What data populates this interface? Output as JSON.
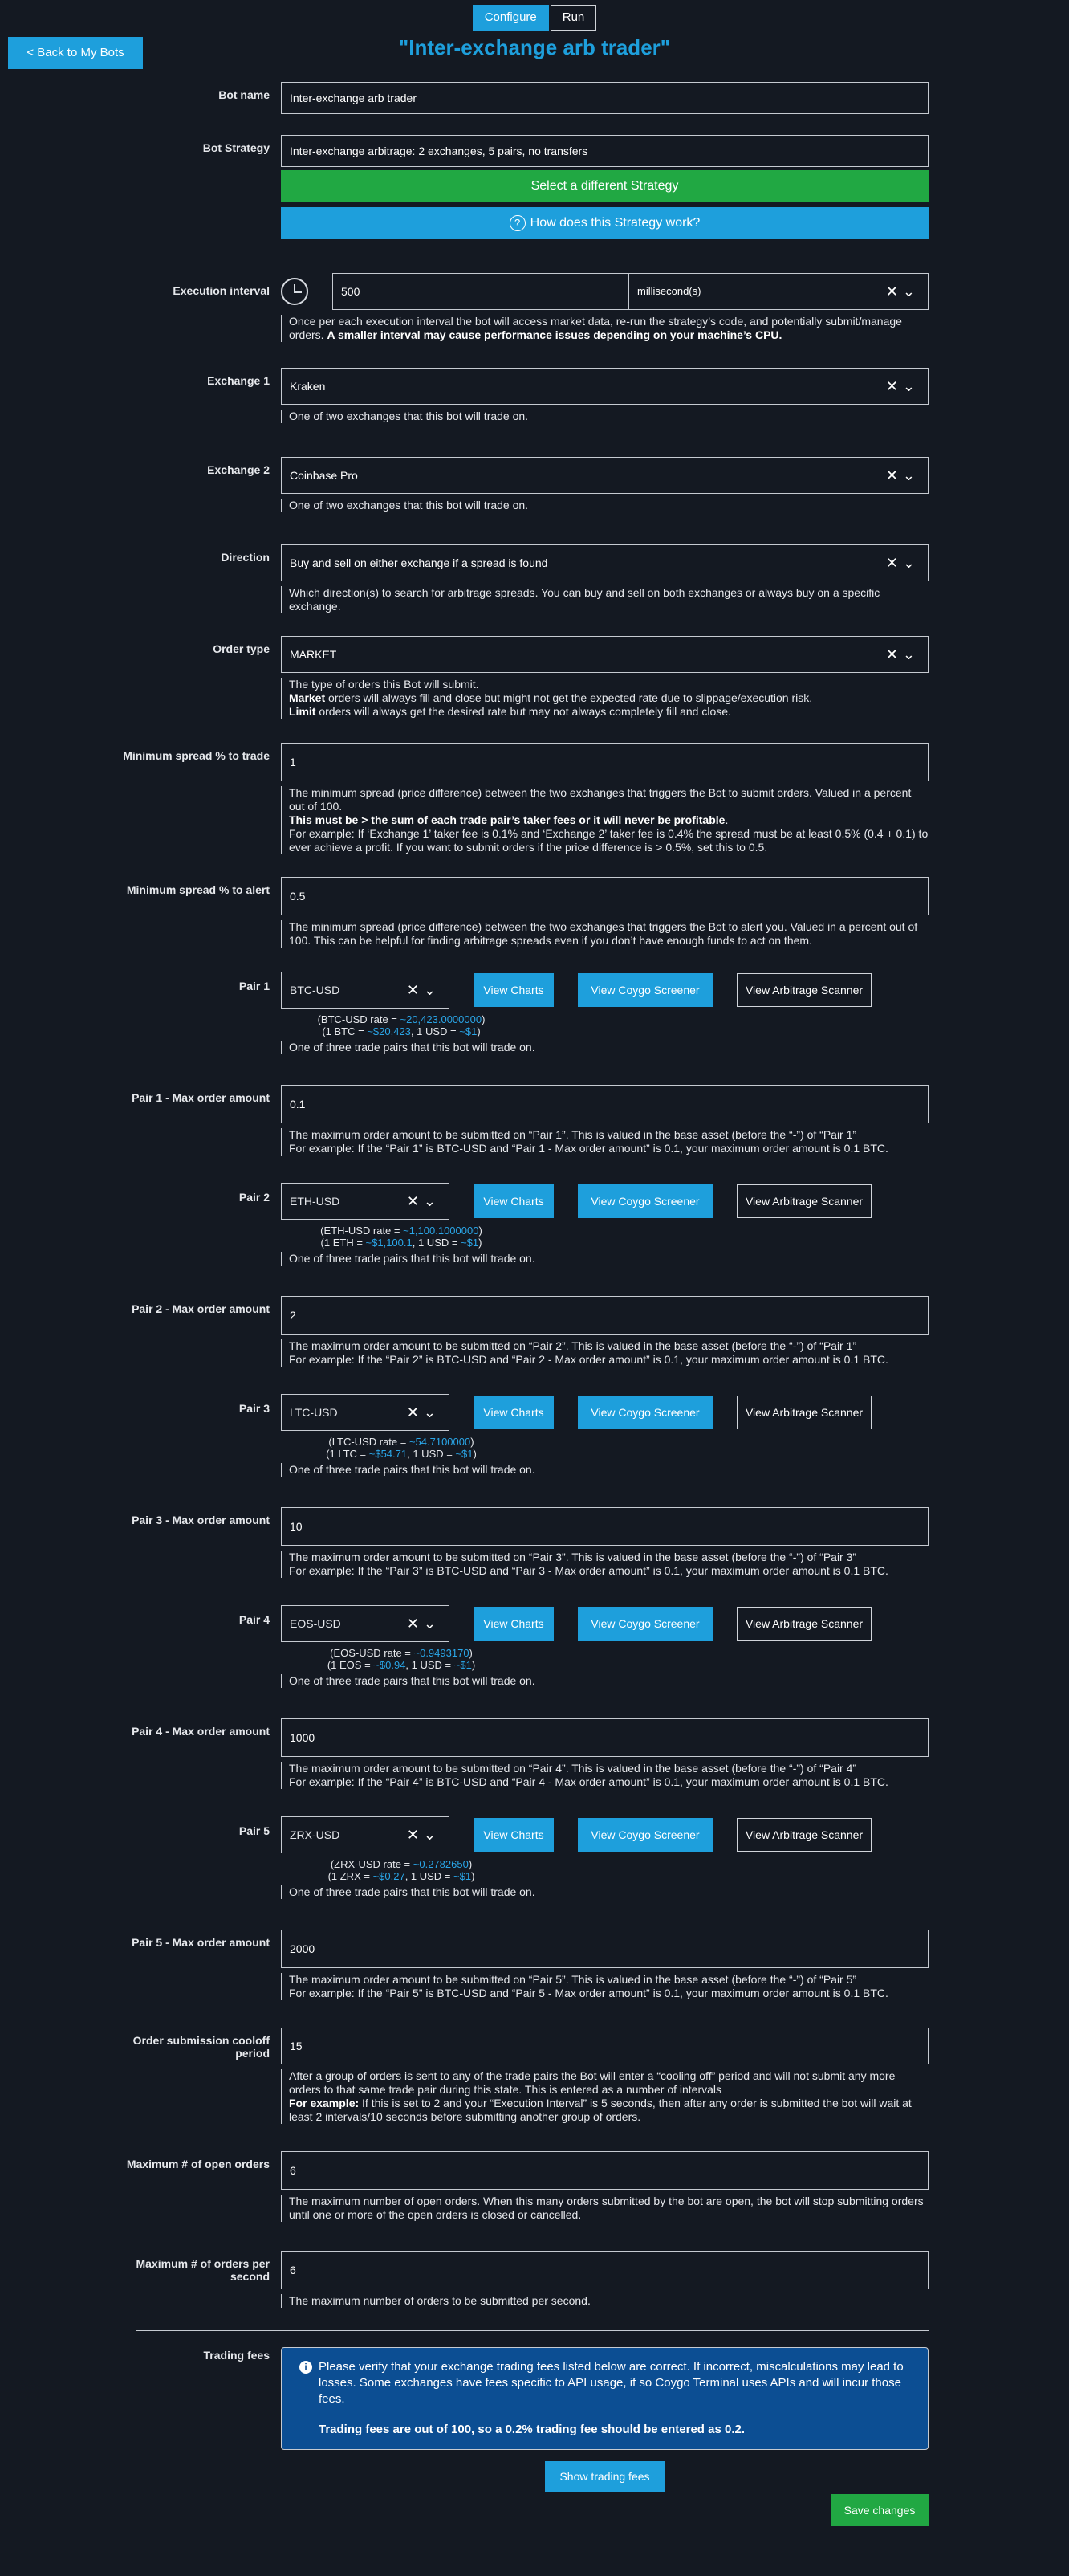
{
  "tabs": [
    "Configure",
    "Run"
  ],
  "back_label": "< Back to My Bots",
  "title": "\"Inter-exchange arb trader\"",
  "bot_name": {
    "label": "Bot name",
    "value": "Inter-exchange arb trader"
  },
  "strategy": {
    "label": "Bot Strategy",
    "value": "Inter-exchange arbitrage: 2 exchanges, 5 pairs, no transfers",
    "select_btn": "Select a different Strategy",
    "how_btn": "How does this Strategy work?"
  },
  "interval": {
    "label": "Execution interval",
    "value": "500",
    "unit": "millisecond(s)",
    "help_plain": "Once per each execution interval the bot will access market data, re-run the strategy’s code, and potentially submit/manage orders.",
    "help_bold": "A smaller interval may cause performance issues depending on your machine’s CPU."
  },
  "exchange1": {
    "label": "Exchange 1",
    "value": "Kraken",
    "help": "One of two exchanges that this bot will trade on."
  },
  "exchange2": {
    "label": "Exchange 2",
    "value": "Coinbase Pro",
    "help": "One of two exchanges that this bot will trade on."
  },
  "direction": {
    "label": "Direction",
    "value": "Buy and sell on either exchange if a spread is found",
    "help": "Which direction(s) to search for arbitrage spreads. You can buy and sell on both exchanges or always buy on a specific exchange."
  },
  "order_type": {
    "label": "Order type",
    "value": "MARKET",
    "help1": "The type of orders this Bot will submit.",
    "help2_bold": "Market",
    "help2": " orders will always fill and close but might not get the expected rate due to slippage/execution risk.",
    "help3_bold": "Limit",
    "help3": " orders will always get the desired rate but may not always completely fill and close."
  },
  "min_trade": {
    "label": "Minimum spread % to trade",
    "value": "1",
    "help1": "The minimum spread (price difference) between the two exchanges that triggers the Bot to submit orders. Valued in a percent out of 100.",
    "help2_bold": "This must be > the sum of each trade pair’s taker fees or it will never be profitable",
    "help2_tail": ".",
    "help3": "For example: If ‘Exchange 1’ taker fee is 0.1% and ‘Exchange 2’ taker fee is 0.4% the spread must be at least 0.5% (0.4 + 0.1) to ever achieve a profit. If you want to submit orders if the price difference is > 0.5%, set this to 0.5."
  },
  "min_alert": {
    "label": "Minimum spread % to alert",
    "value": "0.5",
    "help": "The minimum spread (price difference) between the two exchanges that triggers the Bot to alert you. Valued in a percent out of 100. This can be helpful for finding arbitrage spreads even if you don’t have enough funds to act on them."
  },
  "pair_buttons": {
    "charts": "View Charts",
    "screener": "View Coygo Screener",
    "scanner": "View Arbitrage Scanner"
  },
  "pairs": [
    {
      "label": "Pair 1",
      "value": "BTC-USD",
      "rate_a": "(BTC-USD rate = ",
      "rate_v": "~20,423.0000000",
      "rate_b": ")",
      "conv_a": "(1 BTC = ",
      "conv_v1": "~$20,423",
      "conv_b": ", 1 USD = ",
      "conv_v2": "~$1",
      "conv_c": ")",
      "help": "One of three trade pairs that this bot will trade on.",
      "max_label": "Pair 1 - Max order amount",
      "max_value": "0.1",
      "max_help1": "The maximum order amount to be submitted on “Pair 1”. This is valued in the base asset (before the “-”) of “Pair 1”",
      "max_help2": "For example: If the “Pair 1” is BTC-USD and “Pair 1 - Max order amount” is 0.1, your maximum order amount is 0.1 BTC."
    },
    {
      "label": "Pair 2",
      "value": "ETH-USD",
      "rate_a": "(ETH-USD rate = ",
      "rate_v": "~1,100.1000000",
      "rate_b": ")",
      "conv_a": "(1 ETH = ",
      "conv_v1": "~$1,100.1",
      "conv_b": ", 1 USD = ",
      "conv_v2": "~$1",
      "conv_c": ")",
      "help": "One of three trade pairs that this bot will trade on.",
      "max_label": "Pair 2 - Max order amount",
      "max_value": "2",
      "max_help1": "The maximum order amount to be submitted on “Pair 2”. This is valued in the base asset (before the “-”) of “Pair 1”",
      "max_help2": "For example: If the “Pair 2” is BTC-USD and “Pair 2 - Max order amount” is 0.1, your maximum order amount is 0.1 BTC."
    },
    {
      "label": "Pair 3",
      "value": "LTC-USD",
      "rate_a": "(LTC-USD rate = ",
      "rate_v": "~54.7100000",
      "rate_b": ")",
      "conv_a": "(1 LTC = ",
      "conv_v1": "~$54.71",
      "conv_b": ", 1 USD = ",
      "conv_v2": "~$1",
      "conv_c": ")",
      "help": "One of three trade pairs that this bot will trade on.",
      "max_label": "Pair 3 - Max order amount",
      "max_value": "10",
      "max_help1": "The maximum order amount to be submitted on “Pair 3”. This is valued in the base asset (before the “-”) of “Pair 3”",
      "max_help2": "For example: If the “Pair 3” is BTC-USD and “Pair 3 - Max order amount” is 0.1, your maximum order amount is 0.1 BTC."
    },
    {
      "label": "Pair 4",
      "value": "EOS-USD",
      "rate_a": "(EOS-USD rate = ",
      "rate_v": "~0.9493170",
      "rate_b": ")",
      "conv_a": "(1 EOS = ",
      "conv_v1": "~$0.94",
      "conv_b": ", 1 USD = ",
      "conv_v2": "~$1",
      "conv_c": ")",
      "help": "One of three trade pairs that this bot will trade on.",
      "max_label": "Pair 4 - Max order amount",
      "max_value": "1000",
      "max_help1": "The maximum order amount to be submitted on “Pair 4”. This is valued in the base asset (before the “-”) of “Pair 4”",
      "max_help2": "For example: If the “Pair 4” is BTC-USD and “Pair 4 - Max order amount” is 0.1, your maximum order amount is 0.1 BTC."
    },
    {
      "label": "Pair 5",
      "value": "ZRX-USD",
      "rate_a": "(ZRX-USD rate = ",
      "rate_v": "~0.2782650",
      "rate_b": ")",
      "conv_a": "(1 ZRX = ",
      "conv_v1": "~$0.27",
      "conv_b": ", 1 USD = ",
      "conv_v2": "~$1",
      "conv_c": ")",
      "help": "One of three trade pairs that this bot will trade on.",
      "max_label": "Pair 5 - Max order amount",
      "max_value": "2000",
      "max_help1": "The maximum order amount to be submitted on “Pair 5”. This is valued in the base asset (before the “-”) of “Pair 5”",
      "max_help2": "For example: If the “Pair 5” is BTC-USD and “Pair 5 - Max order amount” is 0.1, your maximum order amount is 0.1 BTC."
    }
  ],
  "cooloff": {
    "label": "Order submission cooloff period",
    "value": "15",
    "help1": "After a group of orders is sent to any of the trade pairs the Bot will enter a “cooling off” period and will not submit any more orders to that same trade pair during this state. This is entered as a number of intervals",
    "help2_bold": "For example:",
    "help2": " If this is set to 2 and your “Execution Interval” is 5 seconds, then after any order is submitted the bot will wait at least 2 intervals/10 seconds before submitting another group of orders."
  },
  "max_open": {
    "label": "Maximum # of open orders",
    "value": "6",
    "help": "The maximum number of open orders. When this many orders submitted by the bot are open, the bot will stop submitting orders until one or more of the open orders is closed or cancelled."
  },
  "max_per_sec": {
    "label": "Maximum # of orders per second",
    "value": "6",
    "help": "The maximum number of orders to be submitted per second."
  },
  "fees": {
    "label": "Trading fees",
    "notice": "Please verify that your exchange trading fees listed below are correct. If incorrect, miscalculations may lead to losses. Some exchanges have fees specific to API usage, if so Coygo Terminal uses APIs and will incur those fees.",
    "notice_bold": "Trading fees are out of 100, so a 0.2% trading fee should be entered as 0.2.",
    "show_btn": "Show trading fees"
  },
  "save_label": "Save changes",
  "colors": {
    "accent": "#1e9fdc",
    "green": "#21a843",
    "background": "#141922",
    "notice": "#0c4e93"
  }
}
